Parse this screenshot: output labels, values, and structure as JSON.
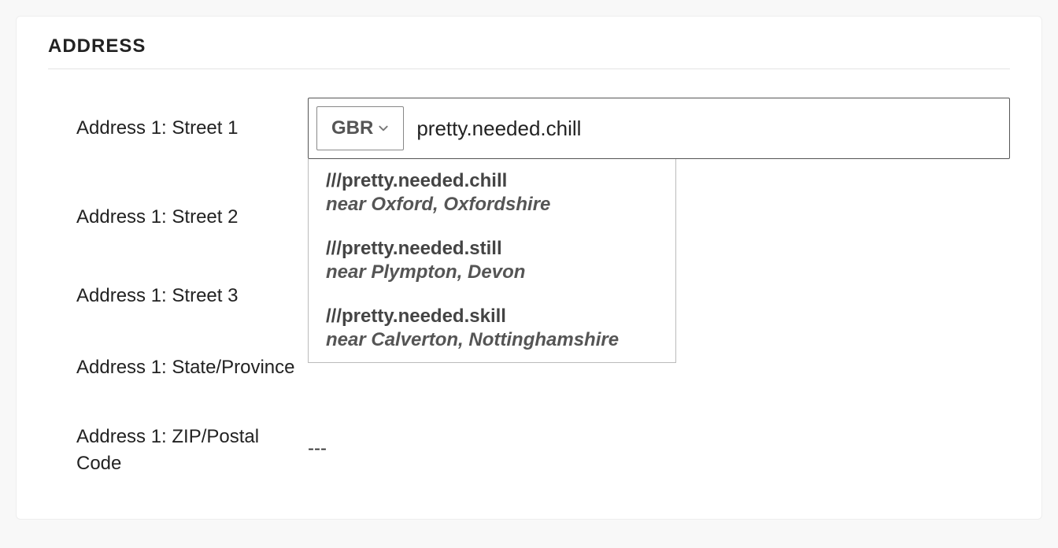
{
  "section_title": "ADDRESS",
  "labels": {
    "street1": "Address 1: Street 1",
    "street2": "Address 1: Street 2",
    "street3": "Address 1: Street 3",
    "state": "Address 1: State/Province",
    "zip": "Address 1: ZIP/Postal Code"
  },
  "country_code": "GBR",
  "street1_value": "pretty.needed.chill",
  "zip_value": "---",
  "suggestions": [
    {
      "address": "///pretty.needed.chill",
      "near": "near Oxford, Oxfordshire"
    },
    {
      "address": "///pretty.needed.still",
      "near": "near Plympton, Devon"
    },
    {
      "address": "///pretty.needed.skill",
      "near": "near Calverton, Nottinghamshire"
    }
  ]
}
